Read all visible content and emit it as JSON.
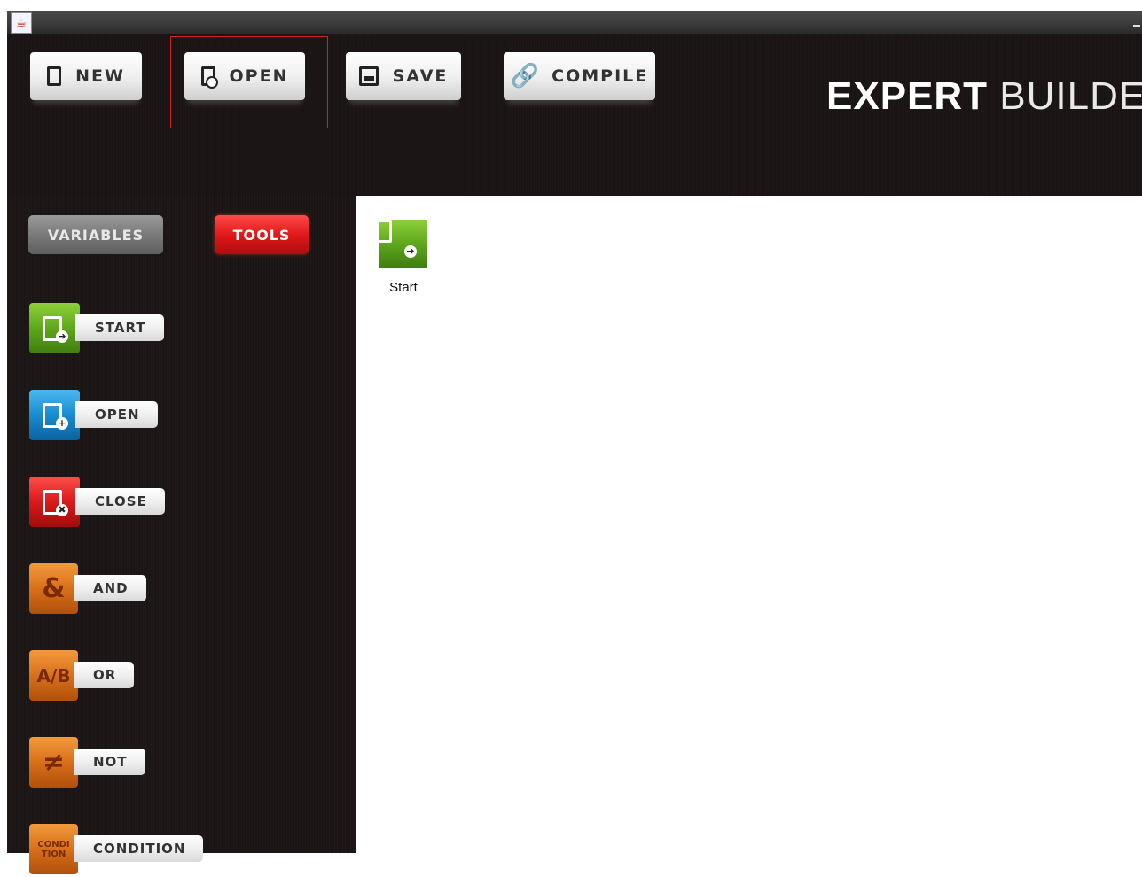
{
  "window": {
    "title_icon": "java-icon"
  },
  "toolbar": {
    "new_label": "NEW",
    "open_label": "OPEN",
    "save_label": "SAVE",
    "compile_label": "COMPILE"
  },
  "brand": {
    "bold": "EXPERT",
    "light": "BUILDER"
  },
  "tabs": {
    "variables": "VARIABLES",
    "tools": "TOOLS"
  },
  "tools": [
    {
      "label": "START",
      "icon": "start-doc-icon",
      "color": "#5fa71d"
    },
    {
      "label": "OPEN",
      "icon": "open-doc-icon",
      "color": "#1a8bd0"
    },
    {
      "label": "CLOSE",
      "icon": "close-doc-icon",
      "color": "#d81a1a"
    },
    {
      "label": "AND",
      "icon": "ampersand-icon",
      "symbol": "&",
      "color": "#d8701a"
    },
    {
      "label": "OR",
      "icon": "a-slash-b-icon",
      "symbol": "A/B",
      "color": "#d8701a"
    },
    {
      "label": "NOT",
      "icon": "not-equal-icon",
      "symbol": "≠",
      "color": "#d8701a"
    },
    {
      "label": "CONDITION",
      "icon": "condition-icon",
      "symbol": "CONDI TION",
      "color": "#d8701a"
    }
  ],
  "canvas": {
    "nodes": [
      {
        "label": "Start",
        "icon": "start-doc-icon"
      }
    ]
  },
  "colors": {
    "accent_red": "#e01818",
    "panel_dark": "#1b1615"
  }
}
